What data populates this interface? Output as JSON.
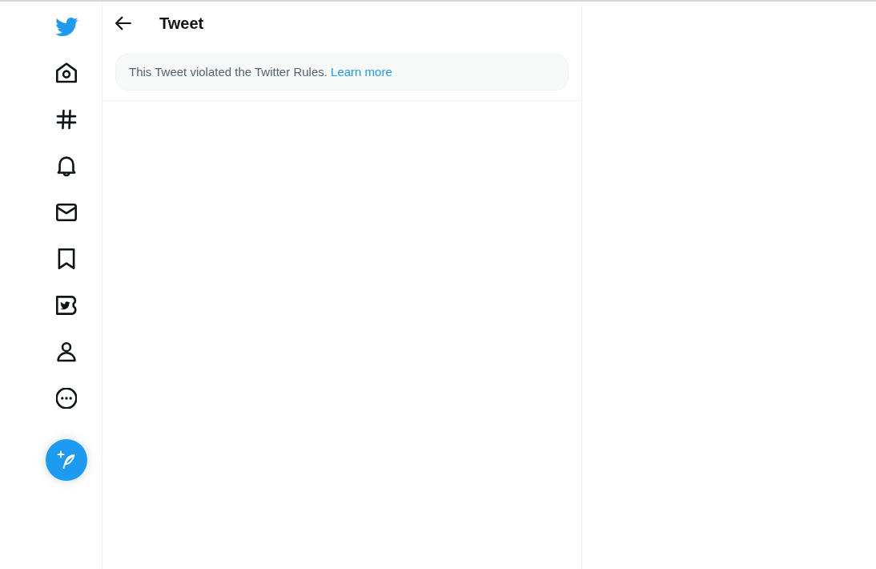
{
  "sidebar": {
    "items": [
      {
        "kind": "home"
      },
      {
        "kind": "explore"
      },
      {
        "kind": "notifications"
      },
      {
        "kind": "messages"
      },
      {
        "kind": "bookmarks"
      },
      {
        "kind": "blue"
      },
      {
        "kind": "profile"
      },
      {
        "kind": "more"
      }
    ]
  },
  "header": {
    "title": "Tweet"
  },
  "notice": {
    "text": "This Tweet violated the Twitter Rules.",
    "link": "Learn more"
  }
}
